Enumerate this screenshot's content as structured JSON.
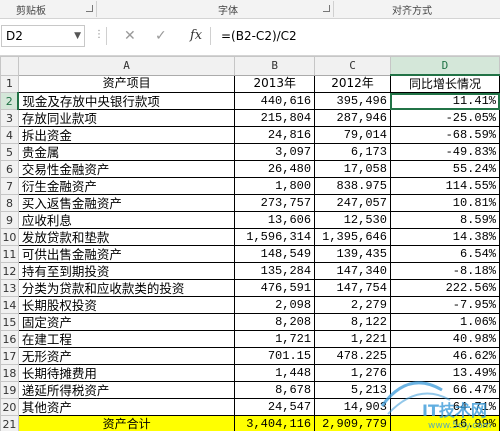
{
  "ribbon": {
    "groups": [
      "剪贴板",
      "字体",
      "对齐方式"
    ]
  },
  "formula_bar": {
    "name_box": "D2",
    "cancel_icon": "✕",
    "enter_icon": "✓",
    "fx_label": "fx",
    "formula": "=(B2-C2)/C2"
  },
  "columns": [
    "A",
    "B",
    "C",
    "D"
  ],
  "active_cell": "D2",
  "header_row": {
    "row": "1",
    "a": "资产项目",
    "b": "2013年",
    "c": "2012年",
    "d": "同比增长情况"
  },
  "rows": [
    {
      "row": "2",
      "a": "现金及存放中央银行款项",
      "b": "440,616",
      "c": "395,496",
      "d": "11.41%"
    },
    {
      "row": "3",
      "a": "存放同业款项",
      "b": "215,804",
      "c": "287,946",
      "d": "-25.05%"
    },
    {
      "row": "4",
      "a": "拆出资金",
      "b": "24,816",
      "c": "79,014",
      "d": "-68.59%"
    },
    {
      "row": "5",
      "a": "贵金属",
      "b": "3,097",
      "c": "6,173",
      "d": "-49.83%"
    },
    {
      "row": "6",
      "a": "交易性金融资产",
      "b": "26,480",
      "c": "17,058",
      "d": "55.24%"
    },
    {
      "row": "7",
      "a": "衍生金融资产",
      "b": "1,800",
      "c": "838.975",
      "d": "114.55%"
    },
    {
      "row": "8",
      "a": "买入返售金融资产",
      "b": "273,757",
      "c": "247,057",
      "d": "10.81%"
    },
    {
      "row": "9",
      "a": "应收利息",
      "b": "13,606",
      "c": "12,530",
      "d": "8.59%"
    },
    {
      "row": "10",
      "a": "发放贷款和垫款",
      "b": "1,596,314",
      "c": "1,395,646",
      "d": "14.38%"
    },
    {
      "row": "11",
      "a": "可供出售金融资产",
      "b": "148,549",
      "c": "139,435",
      "d": "6.54%"
    },
    {
      "row": "12",
      "a": "持有至到期投资",
      "b": "135,284",
      "c": "147,340",
      "d": "-8.18%"
    },
    {
      "row": "13",
      "a": "分类为贷款和应收款类的投资",
      "b": "476,591",
      "c": "147,754",
      "d": "222.56%"
    },
    {
      "row": "14",
      "a": "长期股权投资",
      "b": "2,098",
      "c": "2,279",
      "d": "-7.95%"
    },
    {
      "row": "15",
      "a": "固定资产",
      "b": "8,208",
      "c": "8,122",
      "d": "1.06%"
    },
    {
      "row": "16",
      "a": "在建工程",
      "b": "1,721",
      "c": "1,221",
      "d": "40.98%"
    },
    {
      "row": "17",
      "a": "无形资产",
      "b": "701.15",
      "c": "478.225",
      "d": "46.62%"
    },
    {
      "row": "18",
      "a": "长期待摊费用",
      "b": "1,448",
      "c": "1,276",
      "d": "13.49%"
    },
    {
      "row": "19",
      "a": "递延所得税资产",
      "b": "8,678",
      "c": "5,213",
      "d": "66.47%"
    },
    {
      "row": "20",
      "a": "其他资产",
      "b": "24,547",
      "c": "14,903",
      "d": "64.71%"
    }
  ],
  "total_row": {
    "row": "21",
    "a": "资产合计",
    "b": "3,404,116",
    "c": "2,909,779",
    "d": "16.99%"
  },
  "watermark": {
    "text": "IT技术网",
    "url": "www.5cly.com",
    "color": "#3a9ad9"
  }
}
